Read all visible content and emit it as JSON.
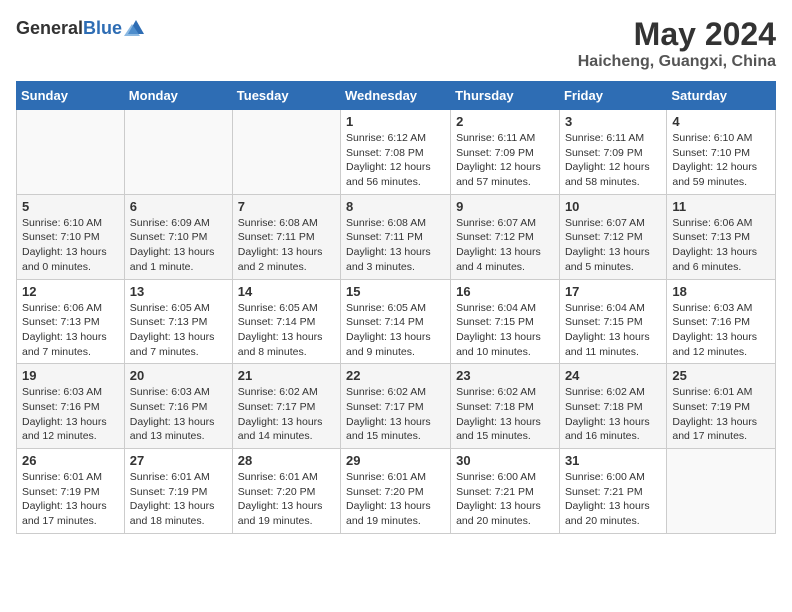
{
  "header": {
    "logo_general": "General",
    "logo_blue": "Blue",
    "month": "May 2024",
    "location": "Haicheng, Guangxi, China"
  },
  "days_of_week": [
    "Sunday",
    "Monday",
    "Tuesday",
    "Wednesday",
    "Thursday",
    "Friday",
    "Saturday"
  ],
  "weeks": [
    [
      {
        "day": "",
        "info": ""
      },
      {
        "day": "",
        "info": ""
      },
      {
        "day": "",
        "info": ""
      },
      {
        "day": "1",
        "info": "Sunrise: 6:12 AM\nSunset: 7:08 PM\nDaylight: 12 hours and 56 minutes."
      },
      {
        "day": "2",
        "info": "Sunrise: 6:11 AM\nSunset: 7:09 PM\nDaylight: 12 hours and 57 minutes."
      },
      {
        "day": "3",
        "info": "Sunrise: 6:11 AM\nSunset: 7:09 PM\nDaylight: 12 hours and 58 minutes."
      },
      {
        "day": "4",
        "info": "Sunrise: 6:10 AM\nSunset: 7:10 PM\nDaylight: 12 hours and 59 minutes."
      }
    ],
    [
      {
        "day": "5",
        "info": "Sunrise: 6:10 AM\nSunset: 7:10 PM\nDaylight: 13 hours and 0 minutes."
      },
      {
        "day": "6",
        "info": "Sunrise: 6:09 AM\nSunset: 7:10 PM\nDaylight: 13 hours and 1 minute."
      },
      {
        "day": "7",
        "info": "Sunrise: 6:08 AM\nSunset: 7:11 PM\nDaylight: 13 hours and 2 minutes."
      },
      {
        "day": "8",
        "info": "Sunrise: 6:08 AM\nSunset: 7:11 PM\nDaylight: 13 hours and 3 minutes."
      },
      {
        "day": "9",
        "info": "Sunrise: 6:07 AM\nSunset: 7:12 PM\nDaylight: 13 hours and 4 minutes."
      },
      {
        "day": "10",
        "info": "Sunrise: 6:07 AM\nSunset: 7:12 PM\nDaylight: 13 hours and 5 minutes."
      },
      {
        "day": "11",
        "info": "Sunrise: 6:06 AM\nSunset: 7:13 PM\nDaylight: 13 hours and 6 minutes."
      }
    ],
    [
      {
        "day": "12",
        "info": "Sunrise: 6:06 AM\nSunset: 7:13 PM\nDaylight: 13 hours and 7 minutes."
      },
      {
        "day": "13",
        "info": "Sunrise: 6:05 AM\nSunset: 7:13 PM\nDaylight: 13 hours and 7 minutes."
      },
      {
        "day": "14",
        "info": "Sunrise: 6:05 AM\nSunset: 7:14 PM\nDaylight: 13 hours and 8 minutes."
      },
      {
        "day": "15",
        "info": "Sunrise: 6:05 AM\nSunset: 7:14 PM\nDaylight: 13 hours and 9 minutes."
      },
      {
        "day": "16",
        "info": "Sunrise: 6:04 AM\nSunset: 7:15 PM\nDaylight: 13 hours and 10 minutes."
      },
      {
        "day": "17",
        "info": "Sunrise: 6:04 AM\nSunset: 7:15 PM\nDaylight: 13 hours and 11 minutes."
      },
      {
        "day": "18",
        "info": "Sunrise: 6:03 AM\nSunset: 7:16 PM\nDaylight: 13 hours and 12 minutes."
      }
    ],
    [
      {
        "day": "19",
        "info": "Sunrise: 6:03 AM\nSunset: 7:16 PM\nDaylight: 13 hours and 12 minutes."
      },
      {
        "day": "20",
        "info": "Sunrise: 6:03 AM\nSunset: 7:16 PM\nDaylight: 13 hours and 13 minutes."
      },
      {
        "day": "21",
        "info": "Sunrise: 6:02 AM\nSunset: 7:17 PM\nDaylight: 13 hours and 14 minutes."
      },
      {
        "day": "22",
        "info": "Sunrise: 6:02 AM\nSunset: 7:17 PM\nDaylight: 13 hours and 15 minutes."
      },
      {
        "day": "23",
        "info": "Sunrise: 6:02 AM\nSunset: 7:18 PM\nDaylight: 13 hours and 15 minutes."
      },
      {
        "day": "24",
        "info": "Sunrise: 6:02 AM\nSunset: 7:18 PM\nDaylight: 13 hours and 16 minutes."
      },
      {
        "day": "25",
        "info": "Sunrise: 6:01 AM\nSunset: 7:19 PM\nDaylight: 13 hours and 17 minutes."
      }
    ],
    [
      {
        "day": "26",
        "info": "Sunrise: 6:01 AM\nSunset: 7:19 PM\nDaylight: 13 hours and 17 minutes."
      },
      {
        "day": "27",
        "info": "Sunrise: 6:01 AM\nSunset: 7:19 PM\nDaylight: 13 hours and 18 minutes."
      },
      {
        "day": "28",
        "info": "Sunrise: 6:01 AM\nSunset: 7:20 PM\nDaylight: 13 hours and 19 minutes."
      },
      {
        "day": "29",
        "info": "Sunrise: 6:01 AM\nSunset: 7:20 PM\nDaylight: 13 hours and 19 minutes."
      },
      {
        "day": "30",
        "info": "Sunrise: 6:00 AM\nSunset: 7:21 PM\nDaylight: 13 hours and 20 minutes."
      },
      {
        "day": "31",
        "info": "Sunrise: 6:00 AM\nSunset: 7:21 PM\nDaylight: 13 hours and 20 minutes."
      },
      {
        "day": "",
        "info": ""
      }
    ]
  ]
}
